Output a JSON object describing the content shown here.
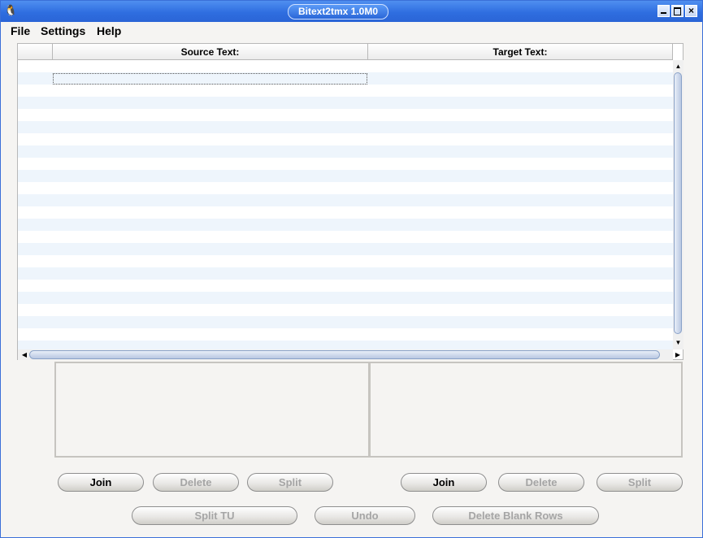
{
  "window": {
    "title": "Bitext2tmx 1.0M0",
    "app_icon": "tux-icon",
    "controls": {
      "minimize": "minimize-icon",
      "maximize": "maximize-icon",
      "close": "×"
    }
  },
  "menubar": {
    "items": [
      {
        "label": "File"
      },
      {
        "label": "Settings"
      },
      {
        "label": "Help"
      }
    ]
  },
  "table": {
    "columns": [
      "",
      "Source Text:",
      "Target Text:"
    ],
    "row_count": 24
  },
  "buttons": {
    "source_join": "Join",
    "source_delete": "Delete",
    "source_split": "Split",
    "target_join": "Join",
    "target_delete": "Delete",
    "target_split": "Split",
    "split_tu": "Split TU",
    "undo": "Undo",
    "delete_blank_rows": "Delete Blank Rows"
  },
  "colors": {
    "title_bar": "#2f6ee0",
    "row_stripe": "#eef5fc",
    "disabled_text": "#a5a5a5"
  }
}
